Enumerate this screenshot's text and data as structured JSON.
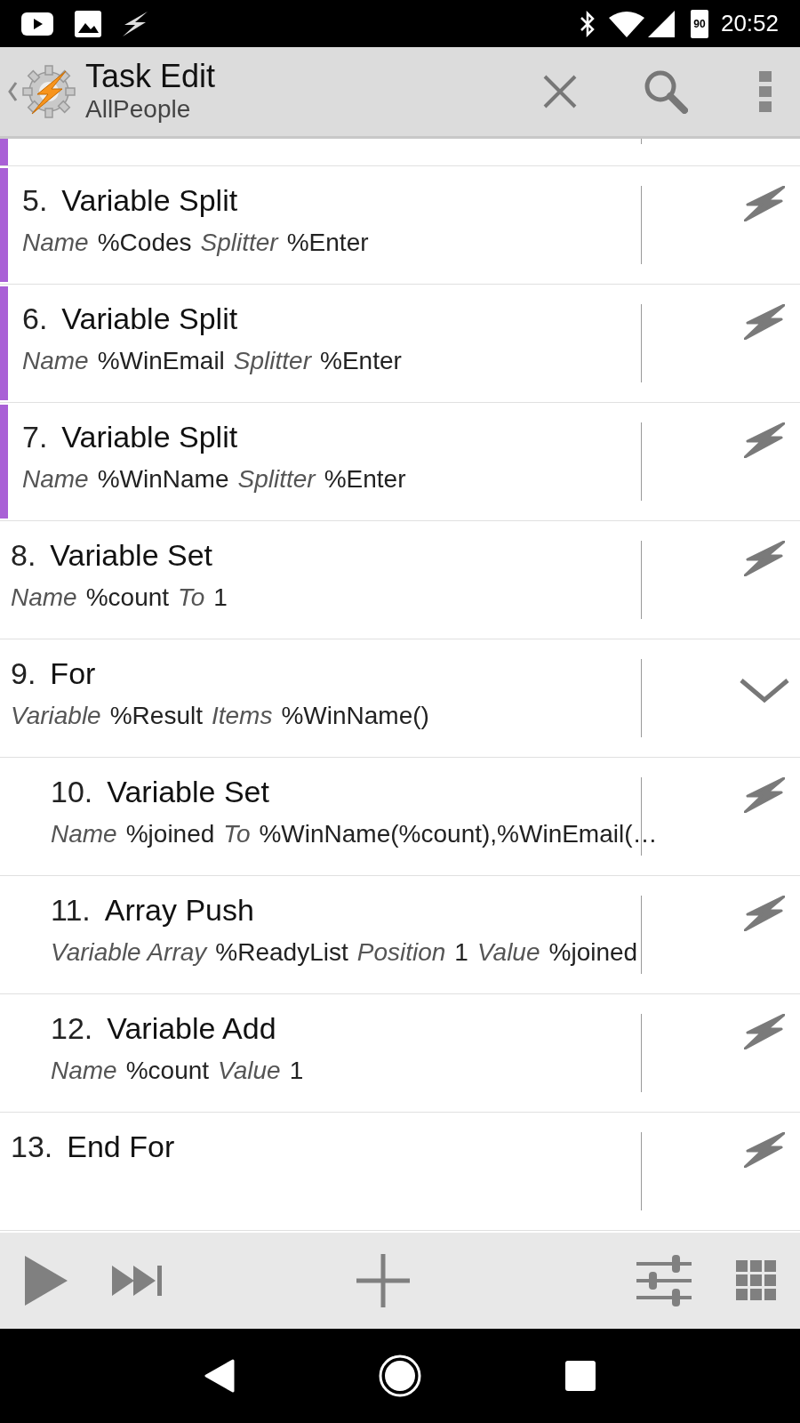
{
  "status_bar": {
    "battery": "90",
    "time": "20:52"
  },
  "app_bar": {
    "title": "Task Edit",
    "subtitle": "AllPeople"
  },
  "partial_row": {
    "color": "#a960d6"
  },
  "actions": [
    {
      "number": "5.",
      "title": "Variable Split",
      "color": "#a960d6",
      "params": [
        {
          "kind": "label",
          "text": "Name"
        },
        {
          "kind": "value",
          "text": "%Codes"
        },
        {
          "kind": "label",
          "text": "Splitter"
        },
        {
          "kind": "value",
          "text": "%Enter"
        }
      ]
    },
    {
      "number": "6.",
      "title": "Variable Split",
      "color": "#a960d6",
      "params": [
        {
          "kind": "label",
          "text": "Name"
        },
        {
          "kind": "value",
          "text": "%WinEmail"
        },
        {
          "kind": "label",
          "text": "Splitter"
        },
        {
          "kind": "value",
          "text": "%Enter"
        }
      ]
    },
    {
      "number": "7.",
      "title": "Variable Split",
      "color": "#a960d6",
      "params": [
        {
          "kind": "label",
          "text": "Name"
        },
        {
          "kind": "value",
          "text": "%WinName"
        },
        {
          "kind": "label",
          "text": "Splitter"
        },
        {
          "kind": "value",
          "text": "%Enter"
        }
      ]
    },
    {
      "number": "8.",
      "title": "Variable Set",
      "params": [
        {
          "kind": "label",
          "text": "Name"
        },
        {
          "kind": "value",
          "text": "%count"
        },
        {
          "kind": "label",
          "text": "To"
        },
        {
          "kind": "value",
          "text": "1"
        }
      ]
    },
    {
      "number": "9.",
      "title": "For",
      "expanded": true,
      "params": [
        {
          "kind": "label",
          "text": "Variable"
        },
        {
          "kind": "value",
          "text": "%Result"
        },
        {
          "kind": "label",
          "text": "Items"
        },
        {
          "kind": "value",
          "text": "%WinName()"
        }
      ],
      "children": [
        {
          "number": "10.",
          "title": "Variable Set",
          "params": [
            {
              "kind": "label",
              "text": "Name"
            },
            {
              "kind": "value",
              "text": "%joined"
            },
            {
              "kind": "label",
              "text": "To"
            },
            {
              "kind": "value",
              "text": "%WinName(%count),%WinEmail(…"
            }
          ]
        },
        {
          "number": "11.",
          "title": "Array Push",
          "params": [
            {
              "kind": "label",
              "text": "Variable Array"
            },
            {
              "kind": "value",
              "text": "%ReadyList"
            },
            {
              "kind": "label",
              "text": "Position"
            },
            {
              "kind": "value",
              "text": "1"
            },
            {
              "kind": "label",
              "text": "Value"
            },
            {
              "kind": "value",
              "text": "%joined"
            }
          ]
        },
        {
          "number": "12.",
          "title": "Variable Add",
          "params": [
            {
              "kind": "label",
              "text": "Name"
            },
            {
              "kind": "value",
              "text": "%count"
            },
            {
              "kind": "label",
              "text": "Value"
            },
            {
              "kind": "value",
              "text": "1"
            }
          ]
        }
      ]
    },
    {
      "number": "13.",
      "title": "End For"
    }
  ]
}
